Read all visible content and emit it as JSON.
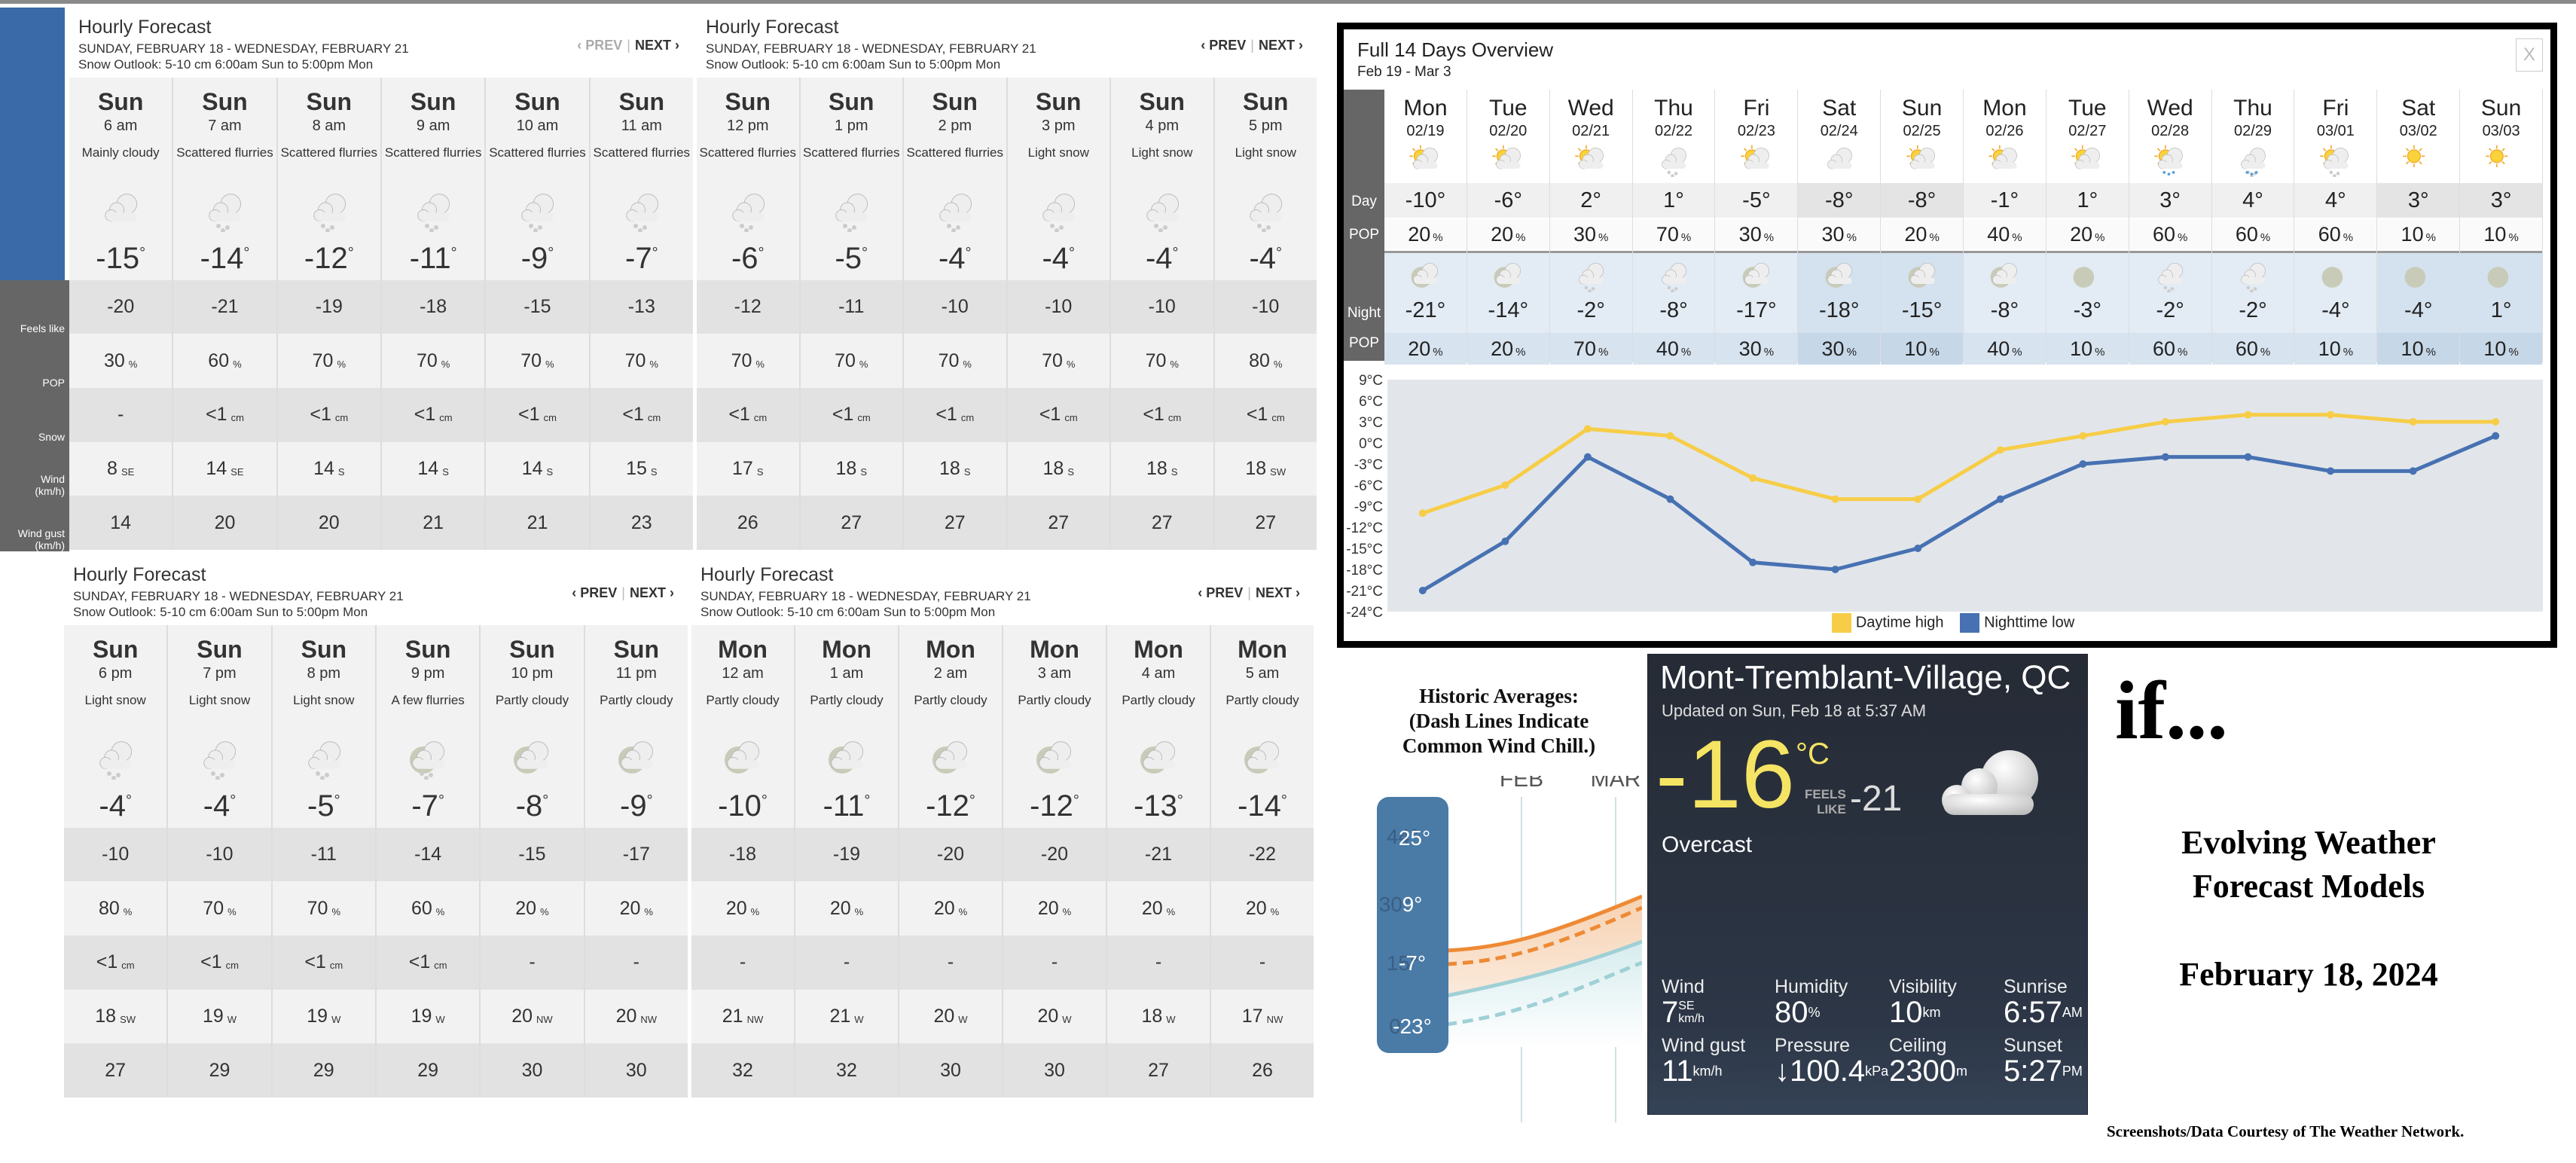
{
  "hourly_panels": [
    {
      "title": "Hourly Forecast",
      "date_range": "SUNDAY, FEBRUARY 18 - WEDNESDAY, FEBRUARY 21",
      "snow_outlook": "Snow Outlook: 5-10 cm 6:00am Sun to 5:00pm Mon",
      "prev_label": "‹ PREV",
      "next_label": "NEXT ›",
      "prev_disabled": true,
      "hours": [
        {
          "day": "Sun",
          "time": "6 am",
          "condition": "Mainly cloudy",
          "icon": "cloudy-icon",
          "temp": "-15",
          "feels": "-20",
          "pop": "30",
          "snow": "-",
          "snow_unit": "",
          "wind": "8",
          "wind_dir": "SE",
          "gust": "14"
        },
        {
          "day": "Sun",
          "time": "7 am",
          "condition": "Scattered flurries",
          "icon": "snow-cloud-icon",
          "temp": "-14",
          "feels": "-21",
          "pop": "60",
          "snow": "<1",
          "snow_unit": "cm",
          "wind": "14",
          "wind_dir": "SE",
          "gust": "20"
        },
        {
          "day": "Sun",
          "time": "8 am",
          "condition": "Scattered flurries",
          "icon": "snow-cloud-icon",
          "temp": "-12",
          "feels": "-19",
          "pop": "70",
          "snow": "<1",
          "snow_unit": "cm",
          "wind": "14",
          "wind_dir": "S",
          "gust": "20"
        },
        {
          "day": "Sun",
          "time": "9 am",
          "condition": "Scattered flurries",
          "icon": "snow-cloud-icon",
          "temp": "-11",
          "feels": "-18",
          "pop": "70",
          "snow": "<1",
          "snow_unit": "cm",
          "wind": "14",
          "wind_dir": "S",
          "gust": "21"
        },
        {
          "day": "Sun",
          "time": "10 am",
          "condition": "Scattered flurries",
          "icon": "snow-cloud-icon",
          "temp": "-9",
          "feels": "-15",
          "pop": "70",
          "snow": "<1",
          "snow_unit": "cm",
          "wind": "14",
          "wind_dir": "S",
          "gust": "21"
        },
        {
          "day": "Sun",
          "time": "11 am",
          "condition": "Scattered flurries",
          "icon": "snow-cloud-icon",
          "temp": "-7",
          "feels": "-13",
          "pop": "70",
          "snow": "<1",
          "snow_unit": "cm",
          "wind": "15",
          "wind_dir": "S",
          "gust": "23"
        }
      ]
    },
    {
      "title": "Hourly Forecast",
      "date_range": "SUNDAY, FEBRUARY 18 - WEDNESDAY, FEBRUARY 21",
      "snow_outlook": "Snow Outlook: 5-10 cm 6:00am Sun to 5:00pm Mon",
      "prev_label": "‹ PREV",
      "next_label": "NEXT ›",
      "prev_disabled": false,
      "hours": [
        {
          "day": "Sun",
          "time": "12 pm",
          "condition": "Scattered flurries",
          "icon": "snow-cloud-icon",
          "temp": "-6",
          "feels": "-12",
          "pop": "70",
          "snow": "<1",
          "snow_unit": "cm",
          "wind": "17",
          "wind_dir": "S",
          "gust": "26"
        },
        {
          "day": "Sun",
          "time": "1 pm",
          "condition": "Scattered flurries",
          "icon": "snow-cloud-icon",
          "temp": "-5",
          "feels": "-11",
          "pop": "70",
          "snow": "<1",
          "snow_unit": "cm",
          "wind": "18",
          "wind_dir": "S",
          "gust": "27"
        },
        {
          "day": "Sun",
          "time": "2 pm",
          "condition": "Scattered flurries",
          "icon": "snow-cloud-icon",
          "temp": "-4",
          "feels": "-10",
          "pop": "70",
          "snow": "<1",
          "snow_unit": "cm",
          "wind": "18",
          "wind_dir": "S",
          "gust": "27"
        },
        {
          "day": "Sun",
          "time": "3 pm",
          "condition": "Light snow",
          "icon": "snow-cloud-icon",
          "temp": "-4",
          "feels": "-10",
          "pop": "70",
          "snow": "<1",
          "snow_unit": "cm",
          "wind": "18",
          "wind_dir": "S",
          "gust": "27"
        },
        {
          "day": "Sun",
          "time": "4 pm",
          "condition": "Light snow",
          "icon": "snow-cloud-icon",
          "temp": "-4",
          "feels": "-10",
          "pop": "70",
          "snow": "<1",
          "snow_unit": "cm",
          "wind": "18",
          "wind_dir": "S",
          "gust": "27"
        },
        {
          "day": "Sun",
          "time": "5 pm",
          "condition": "Light snow",
          "icon": "snow-cloud-icon",
          "temp": "-4",
          "feels": "-10",
          "pop": "80",
          "snow": "<1",
          "snow_unit": "cm",
          "wind": "18",
          "wind_dir": "SW",
          "gust": "27"
        }
      ]
    },
    {
      "title": "Hourly Forecast",
      "date_range": "SUNDAY, FEBRUARY 18 - WEDNESDAY, FEBRUARY 21",
      "snow_outlook": "Snow Outlook: 5-10 cm 6:00am Sun to 5:00pm Mon",
      "prev_label": "‹ PREV",
      "next_label": "NEXT ›",
      "prev_disabled": false,
      "hours": [
        {
          "day": "Sun",
          "time": "6 pm",
          "condition": "Light snow",
          "icon": "snow-cloud-icon",
          "temp": "-4",
          "feels": "-10",
          "pop": "80",
          "snow": "<1",
          "snow_unit": "cm",
          "wind": "18",
          "wind_dir": "SW",
          "gust": "27"
        },
        {
          "day": "Sun",
          "time": "7 pm",
          "condition": "Light snow",
          "icon": "snow-cloud-icon",
          "temp": "-4",
          "feels": "-10",
          "pop": "70",
          "snow": "<1",
          "snow_unit": "cm",
          "wind": "19",
          "wind_dir": "W",
          "gust": "29"
        },
        {
          "day": "Sun",
          "time": "8 pm",
          "condition": "Light snow",
          "icon": "snow-cloud-icon",
          "temp": "-5",
          "feels": "-11",
          "pop": "70",
          "snow": "<1",
          "snow_unit": "cm",
          "wind": "19",
          "wind_dir": "W",
          "gust": "29"
        },
        {
          "day": "Sun",
          "time": "9 pm",
          "condition": "A few flurries",
          "icon": "night-flurries-icon",
          "temp": "-7",
          "feels": "-14",
          "pop": "60",
          "snow": "<1",
          "snow_unit": "cm",
          "wind": "19",
          "wind_dir": "W",
          "gust": "29"
        },
        {
          "day": "Sun",
          "time": "10 pm",
          "condition": "Partly cloudy",
          "icon": "night-cloud-icon",
          "temp": "-8",
          "feels": "-15",
          "pop": "20",
          "snow": "-",
          "snow_unit": "",
          "wind": "20",
          "wind_dir": "NW",
          "gust": "30"
        },
        {
          "day": "Sun",
          "time": "11 pm",
          "condition": "Partly cloudy",
          "icon": "night-cloud-icon",
          "temp": "-9",
          "feels": "-17",
          "pop": "20",
          "snow": "-",
          "snow_unit": "",
          "wind": "20",
          "wind_dir": "NW",
          "gust": "30"
        }
      ]
    },
    {
      "title": "Hourly Forecast",
      "date_range": "SUNDAY, FEBRUARY 18 - WEDNESDAY, FEBRUARY 21",
      "snow_outlook": "Snow Outlook: 5-10 cm 6:00am Sun to 5:00pm Mon",
      "prev_label": "‹ PREV",
      "next_label": "NEXT ›",
      "prev_disabled": false,
      "hours": [
        {
          "day": "Mon",
          "time": "12 am",
          "condition": "Partly cloudy",
          "icon": "night-cloud-icon",
          "temp": "-10",
          "feels": "-18",
          "pop": "20",
          "snow": "-",
          "snow_unit": "",
          "wind": "21",
          "wind_dir": "NW",
          "gust": "32"
        },
        {
          "day": "Mon",
          "time": "1 am",
          "condition": "Partly cloudy",
          "icon": "night-cloud-icon",
          "temp": "-11",
          "feels": "-19",
          "pop": "20",
          "snow": "-",
          "snow_unit": "",
          "wind": "21",
          "wind_dir": "W",
          "gust": "32"
        },
        {
          "day": "Mon",
          "time": "2 am",
          "condition": "Partly cloudy",
          "icon": "night-cloud-icon",
          "temp": "-12",
          "feels": "-20",
          "pop": "20",
          "snow": "-",
          "snow_unit": "",
          "wind": "20",
          "wind_dir": "W",
          "gust": "30"
        },
        {
          "day": "Mon",
          "time": "3 am",
          "condition": "Partly cloudy",
          "icon": "night-cloud-icon",
          "temp": "-12",
          "feels": "-20",
          "pop": "20",
          "snow": "-",
          "snow_unit": "",
          "wind": "20",
          "wind_dir": "W",
          "gust": "30"
        },
        {
          "day": "Mon",
          "time": "4 am",
          "condition": "Partly cloudy",
          "icon": "night-cloud-icon",
          "temp": "-13",
          "feels": "-21",
          "pop": "20",
          "snow": "-",
          "snow_unit": "",
          "wind": "18",
          "wind_dir": "W",
          "gust": "27"
        },
        {
          "day": "Mon",
          "time": "5 am",
          "condition": "Partly cloudy",
          "icon": "night-cloud-icon",
          "temp": "-14",
          "feels": "-22",
          "pop": "20",
          "snow": "-",
          "snow_unit": "",
          "wind": "17",
          "wind_dir": "NW",
          "gust": "26"
        }
      ]
    }
  ],
  "row_labels": [
    "Feels like",
    "POP",
    "Snow",
    "Wind\n(km/h)",
    "Wind gust\n(km/h)"
  ],
  "units": {
    "degree": "°",
    "percent": "%",
    "celsius_degree": "°"
  },
  "overview": {
    "title": "Full 14 Days Overview",
    "range": "Feb 19 - Mar 3",
    "close_label": "X",
    "day_label": "Day",
    "night_label": "Night",
    "pop_label": "POP",
    "days": [
      {
        "dow": "Mon",
        "date": "02/19",
        "day_icon": "sun-cloud-icon",
        "high": "-10",
        "day_pop": "20",
        "night_icon": "moon-cloud-icon",
        "low": "-21",
        "night_pop": "20",
        "weekend": false
      },
      {
        "dow": "Tue",
        "date": "02/20",
        "day_icon": "sun-cloud-icon",
        "high": "-6",
        "day_pop": "20",
        "night_icon": "moon-cloud-icon",
        "low": "-14",
        "night_pop": "20",
        "weekend": false
      },
      {
        "dow": "Wed",
        "date": "02/21",
        "day_icon": "sun-cloud-icon",
        "high": "2",
        "day_pop": "30",
        "night_icon": "snow-cloud-icon",
        "low": "-2",
        "night_pop": "70",
        "weekend": false
      },
      {
        "dow": "Thu",
        "date": "02/22",
        "day_icon": "snow-cloud-icon",
        "high": "1",
        "day_pop": "70",
        "night_icon": "snow-cloud-icon",
        "low": "-8",
        "night_pop": "40",
        "weekend": false
      },
      {
        "dow": "Fri",
        "date": "02/23",
        "day_icon": "sun-cloud-icon",
        "high": "-5",
        "day_pop": "30",
        "night_icon": "moon-cloud-icon",
        "low": "-17",
        "night_pop": "30",
        "weekend": false
      },
      {
        "dow": "Sat",
        "date": "02/24",
        "day_icon": "cloudy-icon",
        "high": "-8",
        "day_pop": "30",
        "night_icon": "moon-cloud-icon",
        "low": "-18",
        "night_pop": "30",
        "weekend": true
      },
      {
        "dow": "Sun",
        "date": "02/25",
        "day_icon": "sun-cloud-icon",
        "high": "-8",
        "day_pop": "20",
        "night_icon": "moon-cloud-icon",
        "low": "-15",
        "night_pop": "10",
        "weekend": true
      },
      {
        "dow": "Mon",
        "date": "02/26",
        "day_icon": "sun-cloud-icon",
        "high": "-1",
        "day_pop": "40",
        "night_icon": "moon-cloud-icon",
        "low": "-8",
        "night_pop": "40",
        "weekend": false
      },
      {
        "dow": "Tue",
        "date": "02/27",
        "day_icon": "sun-cloud-icon",
        "high": "1",
        "day_pop": "20",
        "night_icon": "moon-icon",
        "low": "-3",
        "night_pop": "10",
        "weekend": false
      },
      {
        "dow": "Wed",
        "date": "02/28",
        "day_icon": "sun-rain-icon",
        "high": "3",
        "day_pop": "60",
        "night_icon": "snow-cloud-icon",
        "low": "-2",
        "night_pop": "60",
        "weekend": false
      },
      {
        "dow": "Thu",
        "date": "02/29",
        "day_icon": "rain-snow-icon",
        "high": "4",
        "day_pop": "60",
        "night_icon": "snow-cloud-icon",
        "low": "-2",
        "night_pop": "60",
        "weekend": false
      },
      {
        "dow": "Fri",
        "date": "03/01",
        "day_icon": "sun-snow-icon",
        "high": "4",
        "day_pop": "60",
        "night_icon": "moon-icon",
        "low": "-4",
        "night_pop": "10",
        "weekend": false
      },
      {
        "dow": "Sat",
        "date": "03/02",
        "day_icon": "sun-icon",
        "high": "3",
        "day_pop": "10",
        "night_icon": "moon-icon",
        "low": "-4",
        "night_pop": "10",
        "weekend": true
      },
      {
        "dow": "Sun",
        "date": "03/03",
        "day_icon": "sun-icon",
        "high": "3",
        "day_pop": "10",
        "night_icon": "moon-icon",
        "low": "1",
        "night_pop": "10",
        "weekend": true
      }
    ]
  },
  "chart_data": [
    {
      "type": "line",
      "title": "",
      "xlabel": "",
      "ylabel": "",
      "x": [
        "02/19",
        "02/20",
        "02/21",
        "02/22",
        "02/23",
        "02/24",
        "02/25",
        "02/26",
        "02/27",
        "02/28",
        "02/29",
        "03/01",
        "03/02",
        "03/03"
      ],
      "series": [
        {
          "name": "Daytime high",
          "color": "#f7cd48",
          "values": [
            -10,
            -6,
            2,
            1,
            -5,
            -8,
            -8,
            -1,
            1,
            3,
            4,
            4,
            3,
            3
          ]
        },
        {
          "name": "Nighttime low",
          "color": "#4771b2",
          "values": [
            -21,
            -14,
            -2,
            -8,
            -17,
            -18,
            -15,
            -8,
            -3,
            -2,
            -2,
            -4,
            -4,
            1
          ]
        }
      ],
      "y_ticks": [
        "9°C",
        "6°C",
        "3°C",
        "0°C",
        "-3°C",
        "-6°C",
        "-9°C",
        "-12°C",
        "-15°C",
        "-18°C",
        "-21°C",
        "-24°C"
      ],
      "ylim": [
        -24,
        9
      ],
      "grid": false,
      "legend": "bottom-center"
    },
    {
      "type": "area",
      "title": "Historic Averages:\n(Dash Lines Indicate\nCommon Wind Chill.)",
      "x_ticks": [
        "FEB",
        "MAR"
      ],
      "y_ticks": [
        "25°",
        "9°",
        "-7°",
        "-23°"
      ],
      "ghost_y_ticks": [
        "44°",
        "30°",
        "15°",
        "0"
      ],
      "series": [
        {
          "name": "Average high",
          "color": "#ee8a35",
          "style": "solid"
        },
        {
          "name": "Average high wind chill",
          "color": "#ee8a35",
          "style": "dashed"
        },
        {
          "name": "Average low",
          "color": "#9fd0d6",
          "style": "solid"
        },
        {
          "name": "Average low wind chill",
          "color": "#9fd0d6",
          "style": "dashed"
        }
      ]
    }
  ],
  "current": {
    "location": "Mont-Tremblant-Village, QC",
    "updated": "Updated on Sun, Feb 18 at 5:37 AM",
    "temp": "-16",
    "unit": "°C",
    "feels_label_1": "FEELS",
    "feels_label_2": "LIKE",
    "feels_like": "-21",
    "condition": "Overcast",
    "stats": [
      {
        "label": "Wind",
        "value": "7",
        "unit_top": "SE",
        "unit_bottom": "km/h"
      },
      {
        "label": "Humidity",
        "value": "80",
        "unit": "%"
      },
      {
        "label": "Visibility",
        "value": "10",
        "unit": "km"
      },
      {
        "label": "Sunrise",
        "value": "6:57",
        "unit": "AM"
      },
      {
        "label": "Wind gust",
        "value": "11",
        "unit": "km/h"
      },
      {
        "label": "Pressure",
        "value": "↓100.4",
        "unit": "kPa"
      },
      {
        "label": "Ceiling",
        "value": "2300",
        "unit": "m"
      },
      {
        "label": "Sunset",
        "value": "5:27",
        "unit": "PM"
      }
    ]
  },
  "annotation": {
    "if_text": "if...",
    "headline_1": "Evolving Weather",
    "headline_2": "Forecast Models",
    "date": "February 18, 2024",
    "credit": "Screenshots/Data Courtesy of The Weather Network."
  }
}
